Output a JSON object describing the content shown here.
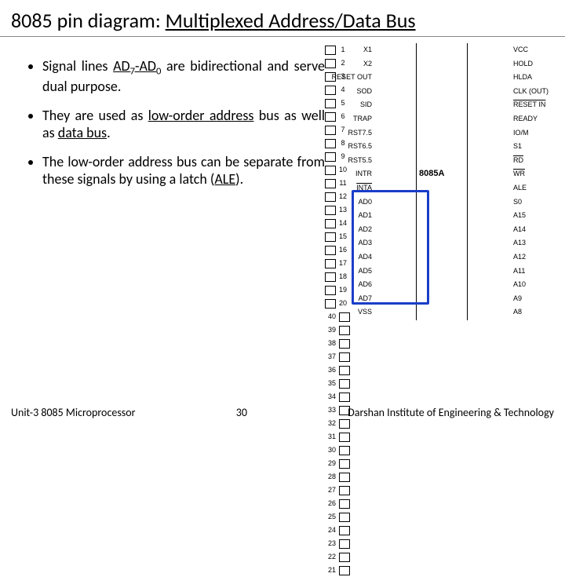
{
  "title_prefix": "8085 pin diagram: ",
  "title_main": "Multiplexed Address/Data Bus",
  "bullets": {
    "b1a": "Signal lines ",
    "b1_sig": "AD",
    "b1_sub1": "7",
    "b1_dash": "-AD",
    "b1_sub2": "0",
    "b1b": " are bidirectional and serve dual purpose.",
    "b2a": "They are used as ",
    "b2_u1": "low-order address",
    "b2b": " bus as well as ",
    "b2_u2": "data bus",
    "b2c": ".",
    "b3a": "The low-order address bus can be separate from these signals by using a latch (",
    "b3_u": "ALE",
    "b3b": ")."
  },
  "chip_label": "8085A",
  "pins_left": [
    {
      "n": "1",
      "l": "X1",
      "ov": false
    },
    {
      "n": "2",
      "l": "X2",
      "ov": false
    },
    {
      "n": "3",
      "l": "RESET OUT",
      "ov": false
    },
    {
      "n": "4",
      "l": "SOD",
      "ov": false
    },
    {
      "n": "5",
      "l": "SID",
      "ov": false
    },
    {
      "n": "6",
      "l": "TRAP",
      "ov": false
    },
    {
      "n": "7",
      "l": "RST7.5",
      "ov": false
    },
    {
      "n": "8",
      "l": "RST6.5",
      "ov": false
    },
    {
      "n": "9",
      "l": "RST5.5",
      "ov": false
    },
    {
      "n": "10",
      "l": "INTR",
      "ov": false
    },
    {
      "n": "11",
      "l": "INTA",
      "ov": true
    },
    {
      "n": "12",
      "l": "AD0",
      "ov": false
    },
    {
      "n": "13",
      "l": "AD1",
      "ov": false
    },
    {
      "n": "14",
      "l": "AD2",
      "ov": false
    },
    {
      "n": "15",
      "l": "AD3",
      "ov": false
    },
    {
      "n": "16",
      "l": "AD4",
      "ov": false
    },
    {
      "n": "17",
      "l": "AD5",
      "ov": false
    },
    {
      "n": "18",
      "l": "AD6",
      "ov": false
    },
    {
      "n": "19",
      "l": "AD7",
      "ov": false
    },
    {
      "n": "20",
      "l": "VSS",
      "ov": false
    }
  ],
  "pins_right": [
    {
      "n": "40",
      "l": "VCC",
      "ov": false
    },
    {
      "n": "39",
      "l": "HOLD",
      "ov": false
    },
    {
      "n": "38",
      "l": "HLDA",
      "ov": false
    },
    {
      "n": "37",
      "l": "CLK (OUT)",
      "ov": false
    },
    {
      "n": "36",
      "l": "RESET IN",
      "ov": true
    },
    {
      "n": "35",
      "l": "READY",
      "ov": false
    },
    {
      "n": "34",
      "l": "IO/M",
      "ov": false
    },
    {
      "n": "33",
      "l": "S1",
      "ov": false
    },
    {
      "n": "32",
      "l": "RD",
      "ov": true
    },
    {
      "n": "31",
      "l": "WR",
      "ov": true
    },
    {
      "n": "30",
      "l": "ALE",
      "ov": false
    },
    {
      "n": "29",
      "l": "S0",
      "ov": false
    },
    {
      "n": "28",
      "l": "A15",
      "ov": false
    },
    {
      "n": "27",
      "l": "A14",
      "ov": false
    },
    {
      "n": "26",
      "l": "A13",
      "ov": false
    },
    {
      "n": "25",
      "l": "A12",
      "ov": false
    },
    {
      "n": "24",
      "l": "A11",
      "ov": false
    },
    {
      "n": "23",
      "l": "A10",
      "ov": false
    },
    {
      "n": "22",
      "l": "A9",
      "ov": false
    },
    {
      "n": "21",
      "l": "A8",
      "ov": false
    }
  ],
  "footer_left": "Unit-3 8085 Microprocessor",
  "footer_page": "30",
  "footer_right": "Darshan Institute of Engineering & Technology"
}
